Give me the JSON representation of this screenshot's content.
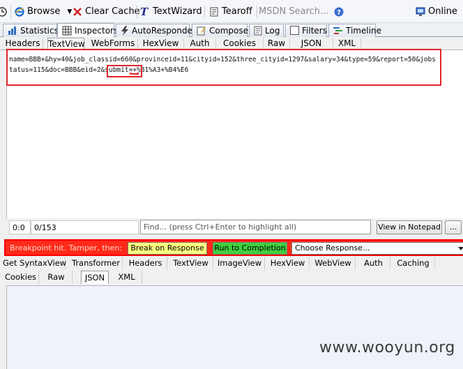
{
  "toolbar": {
    "browse": "Browse",
    "clear_cache": "Clear Cache",
    "textwizard": "TextWizard",
    "tearoff": "Tearoff",
    "msdn_search": "MSDN Search...",
    "online": "Online"
  },
  "main_tabs": [
    "Statistics",
    "Inspectors",
    "AutoResponder",
    "Composer",
    "Log",
    "Filters",
    "Timeline"
  ],
  "request_tabs": [
    "Headers",
    "TextView",
    "WebForms",
    "HexView",
    "Auth",
    "Cookies",
    "Raw",
    "JSON",
    "XML"
  ],
  "request_text": "name=BBB+&hy=40&job_classid=660&provinceid=11&cityid=152&three_cityid=1297&salary=34&type=59&report=50&jobstatus=115&doc=BBB&eid=2&submit=+%B1%A3+%B4%E6",
  "status": {
    "position": "0:0",
    "count": "0/153",
    "find_placeholder": "Find... (press Ctrl+Enter to highlight all)",
    "view_notepad": "View in Notepad",
    "more": "..."
  },
  "breakpoint": {
    "label": "Breakpoint hit. Tamper, then:",
    "break_on_response": "Break on Response",
    "run_to_completion": "Run to Completion",
    "choose_response": "Choose Response..."
  },
  "response_tabs_row1": [
    "Get SyntaxView",
    "Transformer",
    "Headers",
    "TextView",
    "ImageView",
    "HexView",
    "WebView",
    "Auth",
    "Caching"
  ],
  "response_tabs_row2": [
    "Cookies",
    "Raw",
    "JSON",
    "XML"
  ],
  "watermark": "www.wooyun.org",
  "colors": {
    "highlight": "#e0262b",
    "breakpoint_bar": "#ff2a1a",
    "break_button": "#ffff80",
    "run_button": "#40d040"
  }
}
